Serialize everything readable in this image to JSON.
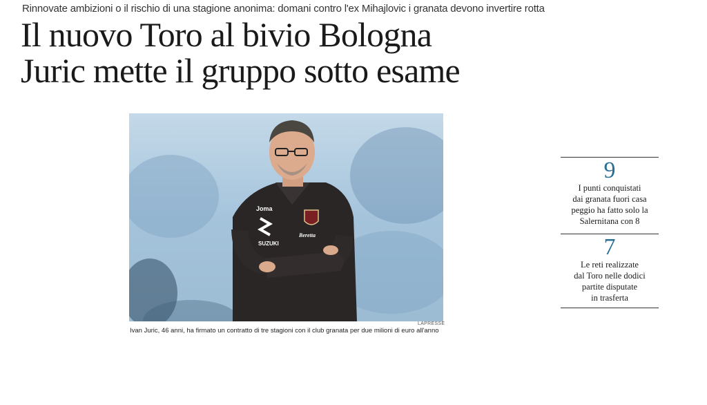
{
  "kicker": "Rinnovate ambizioni o il rischio di una stagione anonima: domani contro l'ex Mihajlovic i granata devono invertire rotta",
  "headline": {
    "line1": "Il nuovo Toro al bivio Bologna",
    "line2": "Juric mette il gruppo sotto esame"
  },
  "photo": {
    "credit": "LAPRESSE",
    "caption": "Ivan Juric, 46 anni, ha firmato un contratto di tre stagioni con il club granata per due milioni di euro all'anno",
    "jersey_sponsor": "SUZUKI",
    "jersey_brand": "Joma",
    "jersey_beer": "Beretta"
  },
  "stats": [
    {
      "number": "9",
      "lines": [
        "I punti conquistati",
        "dai granata fuori casa",
        "peggio ha fatto solo la",
        "Salernitana con 8"
      ]
    },
    {
      "number": "7",
      "lines": [
        "Le reti realizzate",
        "dal Toro nelle dodici",
        "partite disputate",
        "in trasferta"
      ]
    }
  ],
  "colors": {
    "accent_number": "#2b6f92",
    "shirt": "#2a2626",
    "sky_background": "#9ec0da"
  }
}
